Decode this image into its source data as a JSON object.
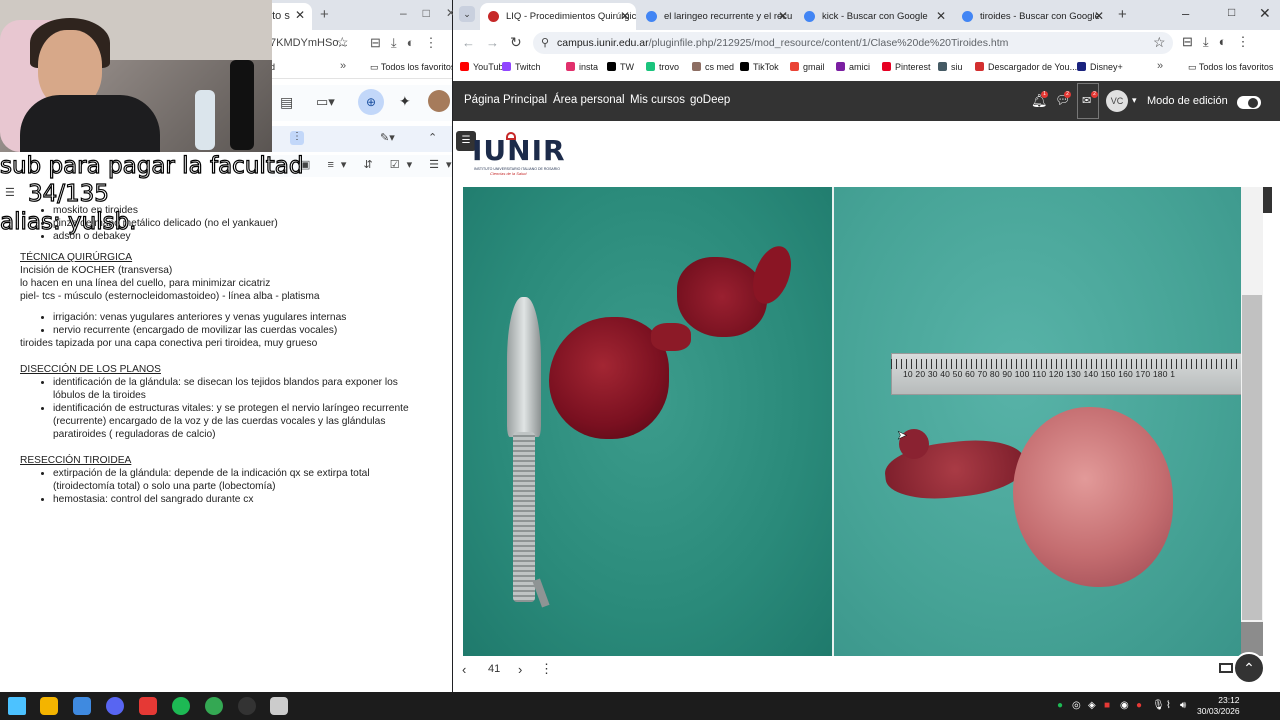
{
  "left_window": {
    "tab_label": "nto s",
    "url_fragment": "7KMDYmHSo...",
    "bookmark_fragment": "d",
    "bookmark_more": "»",
    "bookmark_all": "Todos los favoritos"
  },
  "overlay": {
    "line1": "sub para pagar la facultad",
    "line2": "34/135",
    "line3": "alias: yulsb."
  },
  "doc": {
    "partial_items": [
      "moskito en tiroides",
      "pinza de mano metálico delicado (no el yankauer)",
      "adson o debakey"
    ],
    "section1_title": "TÉCNICA QUIRÚRGICA",
    "section1_lines": [
      "Incisión de KOCHER (transversa)",
      "lo hacen en una línea del cuello, para minimizar cicatriz",
      "piel- tcs - músculo (esternocleidomastoideo) - línea alba - platisma"
    ],
    "section1_items": [
      "irrigación: venas yugulares anteriores y venas yugulares internas",
      "nervio recurrente (encargado de movilizar las cuerdas vocales)"
    ],
    "section1_after": "tiroides tapizada por una capa conectiva peri tiroidea, muy grueso",
    "section2_title": "DISECCIÓN DE LOS PLANOS",
    "section2_items": [
      "identificación de la glándula: se disecan los tejidos blandos para exponer los lóbulos de la tiroides",
      "identificación de estructuras vitales: y se protegen el nervio laríngeo recurrente (recurrente) encargado de la voz y de las cuerdas vocales y las glándulas paratiroides ( reguladoras de calcio)"
    ],
    "section3_title": "RESECCIÓN TIROIDEA",
    "section3_items": [
      "extirpación de la glándula: depende de la indicación qx se extirpa total (tiroidectomía total) o solo una parte (lobectomía)",
      "hemostasia: control del sangrado durante cx"
    ]
  },
  "browser": {
    "tabs": [
      {
        "label": "LIQ - Procedimientos Quirúrgic",
        "color": "#c62828",
        "active": true
      },
      {
        "label": "el laringeo recurrente y el recu",
        "color": "#4285f4",
        "active": false
      },
      {
        "label": "kick - Buscar con Google",
        "color": "#4285f4",
        "active": false
      },
      {
        "label": "tiroides - Buscar con Google",
        "color": "#4285f4",
        "active": false
      }
    ],
    "url_host": "campus.iunir.edu.ar",
    "url_path": "/pluginfile.php/212925/mod_resource/content/1/Clase%20de%20Tiroides.htm",
    "bookmarks": [
      "YouTube",
      "Twitch",
      "insta",
      "TW",
      "trovo",
      "cs med",
      "TikTok",
      "gmail",
      "amici",
      "Pinterest",
      "siu",
      "Descargador de You...",
      "Disney+"
    ],
    "bookmark_colors": [
      "#ff0000",
      "#9146ff",
      "#e1306c",
      "#000000",
      "#1bc47d",
      "#8d6e63",
      "#000000",
      "#ea4335",
      "#7b1fa2",
      "#e60023",
      "#455a64",
      "#d32f2f",
      "#1a237e"
    ],
    "bookmarks_all": "Todos los favoritos"
  },
  "site": {
    "nav": [
      "Página Principal",
      "Área personal",
      "Mis cursos",
      "goDeep"
    ],
    "notif_count": "1",
    "chat_count": "2",
    "mail_count": "2",
    "avatar": "VC",
    "edit_mode_label": "Modo de edición",
    "logo_text": "IUNIR",
    "logo_sub": "INSTITUTO UNIVERSITARIO ITALIANO DE ROSARIO",
    "logo_sub2": "Ciencias de la Salud"
  },
  "slide": {
    "ruler_numbers": "10  20  30  40  50  60  70  80  90  100 110 120 130 140 150 160 170 180 1",
    "page_number": "41"
  },
  "taskbar": {
    "time": "23:12",
    "date": "30/03/2026",
    "icons": [
      {
        "name": "windows",
        "color": "#4cc2ff"
      },
      {
        "name": "file-explorer",
        "color": "#f4b400"
      },
      {
        "name": "store",
        "color": "#3f8ae0"
      },
      {
        "name": "discord",
        "color": "#5865f2"
      },
      {
        "name": "app-red",
        "color": "#e53935"
      },
      {
        "name": "spotify",
        "color": "#1db954"
      },
      {
        "name": "chrome",
        "color": "#34a853"
      },
      {
        "name": "obs",
        "color": "#333333"
      },
      {
        "name": "settings",
        "color": "#cccccc"
      }
    ]
  }
}
